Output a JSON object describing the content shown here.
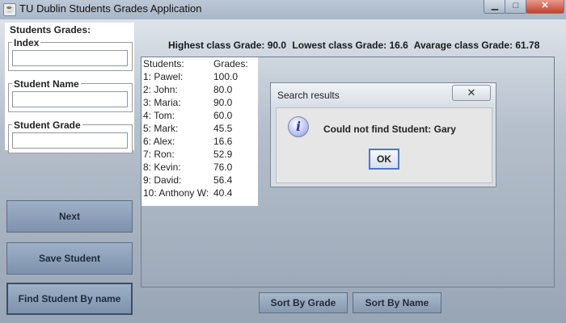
{
  "window": {
    "title": "TU Dublin Students Grades Application",
    "icon": "app-icon"
  },
  "left_panel": {
    "title": "Students Grades:",
    "fields": [
      {
        "label": "Index",
        "value": ""
      },
      {
        "label": "Student Name",
        "value": ""
      },
      {
        "label": "Student Grade",
        "value": ""
      }
    ]
  },
  "buttons": {
    "next": "Next",
    "save": "Save Student",
    "find": "Find Student By name",
    "sort_grade": "Sort By Grade",
    "sort_name": "Sort By Name"
  },
  "stats": {
    "highest": "Highest class Grade: 90.0",
    "lowest": "Lowest class Grade: 16.6",
    "average": "Avarage class Grade: 61.78"
  },
  "list": {
    "header_students": "Students:",
    "header_grades": "Grades:",
    "rows": [
      {
        "name": "1: Pawel:",
        "grade": "100.0"
      },
      {
        "name": "2: John:",
        "grade": "80.0"
      },
      {
        "name": "3: Maria:",
        "grade": "90.0"
      },
      {
        "name": "4: Tom:",
        "grade": "60.0"
      },
      {
        "name": "5: Mark:",
        "grade": "45.5"
      },
      {
        "name": "6: Alex:",
        "grade": "16.6"
      },
      {
        "name": "7: Ron:",
        "grade": "52.9"
      },
      {
        "name": "8: Kevin:",
        "grade": "76.0"
      },
      {
        "name": "9: David:",
        "grade": "56.4"
      },
      {
        "name": "10: Anthony W:",
        "grade": "40.4"
      }
    ]
  },
  "dialog": {
    "title": "Search results",
    "message": "Could not find Student: Gary",
    "ok": "OK",
    "close_symbol": "✕",
    "icon": "info-icon"
  }
}
